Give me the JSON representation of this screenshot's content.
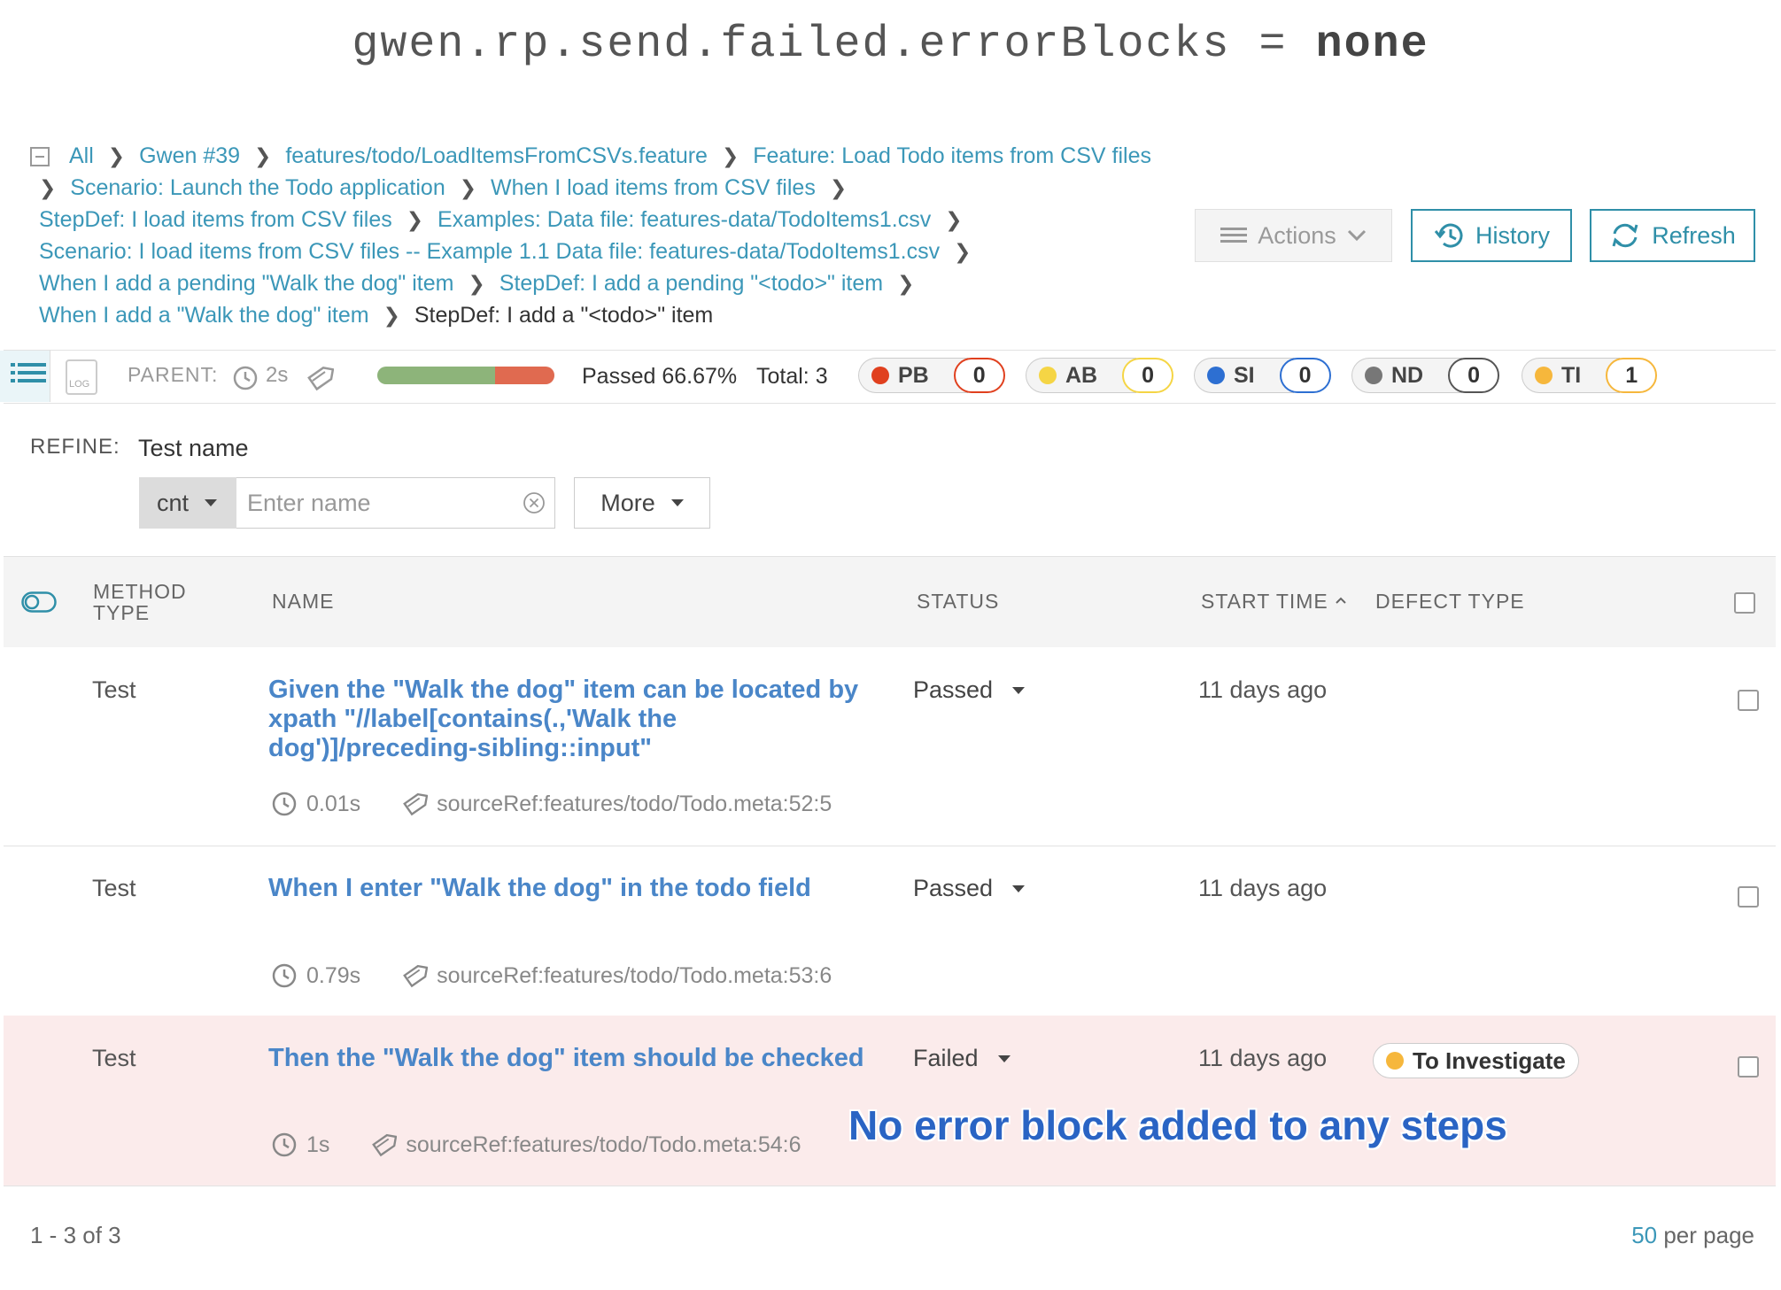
{
  "config": {
    "key": "gwen.rp.send.failed.errorBlocks",
    "eq": "=",
    "value": "none"
  },
  "breadcrumb": {
    "lines": [
      [
        "All",
        "Gwen #39",
        "features/todo/LoadItemsFromCSVs.feature",
        "Feature: Load Todo items from CSV files"
      ],
      [
        "Scenario: Launch the Todo application",
        "When I load items from CSV files"
      ],
      [
        "StepDef: I load items from CSV files",
        "Examples: Data file: features-data/TodoItems1.csv"
      ],
      [
        "Scenario: I load items from CSV files -- Example 1.1 Data file: features-data/TodoItems1.csv"
      ],
      [
        "When I add a pending \"Walk the dog\" item",
        "StepDef: I add a pending \"<todo>\" item"
      ],
      [
        "When I add a \"Walk the dog\" item",
        "StepDef: I add a \"<todo>\" item"
      ]
    ]
  },
  "toolbar": {
    "actions_label": "Actions",
    "history_label": "History",
    "refresh_label": "Refresh"
  },
  "infobar": {
    "log_label": "LOG",
    "parent_label": "PARENT:",
    "duration": "2s",
    "passed_rate": 0.6667,
    "passed_text": "Passed 66.67%",
    "total_text": "Total:  3",
    "defects": [
      {
        "code": "PB",
        "count": "0",
        "color": "#e0401e",
        "border": "#e0401e"
      },
      {
        "code": "AB",
        "count": "0",
        "color": "#f5d545",
        "border": "#f5d545"
      },
      {
        "code": "SI",
        "count": "0",
        "color": "#2d6fd2",
        "border": "#2d6fd2"
      },
      {
        "code": "ND",
        "count": "0",
        "color": "#777777",
        "border": "#555555"
      },
      {
        "code": "TI",
        "count": "1",
        "color": "#f6b73c",
        "border": "#f6b73c"
      }
    ]
  },
  "refine": {
    "label": "REFINE:",
    "test_name_label": "Test name",
    "condition": "cnt",
    "name_placeholder": "Enter name",
    "more_label": "More"
  },
  "table": {
    "headers": {
      "method_type": "METHOD TYPE",
      "name": "NAME",
      "status": "STATUS",
      "start_time": "START TIME",
      "defect_type": "DEFECT TYPE"
    },
    "rows": [
      {
        "method": "Test",
        "name": "Given the \"Walk the dog\" item can be located by xpath \"//label[contains(.,'Walk the dog')]/preceding-sibling::input\"",
        "status": "Passed",
        "start_time": "11 days ago",
        "duration": "0.01s",
        "source_ref": "sourceRef:features/todo/Todo.meta:52:5",
        "defect": ""
      },
      {
        "method": "Test",
        "name": "When I enter \"Walk the dog\" in the todo field",
        "status": "Passed",
        "start_time": "11 days ago",
        "duration": "0.79s",
        "source_ref": "sourceRef:features/todo/Todo.meta:53:6",
        "defect": ""
      },
      {
        "method": "Test",
        "name": "Then the \"Walk the dog\" item should be checked",
        "status": "Failed",
        "start_time": "11 days ago",
        "duration": "1s",
        "source_ref": "sourceRef:features/todo/Todo.meta:54:6",
        "defect": "To Investigate",
        "defect_color": "#f6b73c"
      }
    ]
  },
  "annotation": "No error block added to any steps",
  "pagination": {
    "range": "1 - 3 of 3",
    "per_page_num": "50",
    "per_page_label": "per page"
  }
}
